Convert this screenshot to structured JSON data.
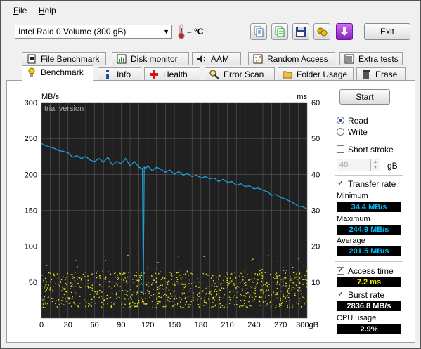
{
  "menu": {
    "file": "File",
    "help": "Help"
  },
  "toolbar": {
    "drive": "Intel   Raid 0 Volume (300 gB)",
    "temperature": "– °C",
    "buttons": [
      "copy-info-icon",
      "copy-text-icon",
      "save-icon",
      "screenshot-icon",
      "download-icon"
    ],
    "exit": "Exit"
  },
  "tabs_top": [
    {
      "label": "File Benchmark",
      "icon": "file-benchmark-icon"
    },
    {
      "label": "Disk monitor",
      "icon": "disk-monitor-icon"
    },
    {
      "label": "AAM",
      "icon": "speaker-icon"
    },
    {
      "label": "Random Access",
      "icon": "random-access-icon"
    },
    {
      "label": "Extra tests",
      "icon": "extra-tests-icon"
    }
  ],
  "tabs_bottom": [
    {
      "label": "Benchmark",
      "icon": "benchmark-icon",
      "active": true
    },
    {
      "label": "Info",
      "icon": "info-icon"
    },
    {
      "label": "Health",
      "icon": "health-cross-icon"
    },
    {
      "label": "Error Scan",
      "icon": "magnifier-icon"
    },
    {
      "label": "Folder Usage",
      "icon": "folder-icon"
    },
    {
      "label": "Erase",
      "icon": "trash-icon"
    }
  ],
  "controls": {
    "start": "Start",
    "read": "Read",
    "write": "Write",
    "short_stroke": "Short stroke",
    "short_stroke_value": "40",
    "short_stroke_unit": "gB",
    "transfer_rate": "Transfer rate",
    "minimum_label": "Minimum",
    "minimum": "34.4 MB/s",
    "maximum_label": "Maximum",
    "maximum": "244.9 MB/s",
    "average_label": "Average",
    "average": "201.5 MB/s",
    "access_time": "Access time",
    "access_time_value": "7.2 ms",
    "burst_rate": "Burst rate",
    "burst_rate_value": "2836.8 MB/s",
    "cpu_usage_label": "CPU usage",
    "cpu_usage": "2.9%"
  },
  "colors": {
    "line": "#1fa3e0",
    "dots": "#e6e619",
    "chart_bg": "#202020",
    "grid": "#5a5a5a",
    "stat_text": "#00bfff"
  },
  "chart_data": {
    "type": "line",
    "watermark": "trial version",
    "y_left_label": "MB/s",
    "y_right_label": "ms",
    "x_ticks": [
      "0",
      "30",
      "60",
      "90",
      "120",
      "150",
      "180",
      "210",
      "240",
      "270",
      "300gB"
    ],
    "y_left_ticks": [
      "300",
      "250",
      "200",
      "150",
      "100",
      "50"
    ],
    "y_right_ticks": [
      "60",
      "50",
      "40",
      "30",
      "20",
      "10"
    ],
    "xlim": [
      0,
      300
    ],
    "ylim_left": [
      0,
      300
    ],
    "ylim_right": [
      0,
      60
    ],
    "transfer_rate_series": {
      "name": "Transfer rate",
      "x": [
        0,
        5,
        10,
        15,
        20,
        25,
        30,
        35,
        40,
        45,
        50,
        55,
        60,
        65,
        70,
        75,
        80,
        85,
        90,
        95,
        100,
        105,
        110,
        114,
        115,
        116,
        118,
        120,
        125,
        130,
        135,
        140,
        145,
        150,
        155,
        160,
        165,
        170,
        175,
        180,
        185,
        190,
        195,
        200,
        205,
        210,
        215,
        220,
        225,
        230,
        235,
        240,
        245,
        250,
        255,
        260,
        265,
        270,
        275,
        280,
        285,
        290,
        295,
        300
      ],
      "y": [
        243,
        240,
        238,
        236,
        233,
        232,
        230,
        224,
        226,
        222,
        225,
        220,
        218,
        222,
        217,
        224,
        213,
        218,
        215,
        222,
        212,
        218,
        210,
        208,
        34,
        210,
        209,
        212,
        205,
        210,
        207,
        203,
        206,
        200,
        204,
        199,
        201,
        197,
        199,
        195,
        197,
        194,
        195,
        190,
        193,
        189,
        190,
        185,
        187,
        183,
        184,
        180,
        181,
        178,
        176,
        171,
        172,
        168,
        166,
        163,
        160,
        156,
        155,
        152
      ]
    },
    "access_time": {
      "name": "Access time",
      "y_range_ms": [
        3,
        13
      ]
    },
    "grid": true,
    "legend": "none"
  }
}
